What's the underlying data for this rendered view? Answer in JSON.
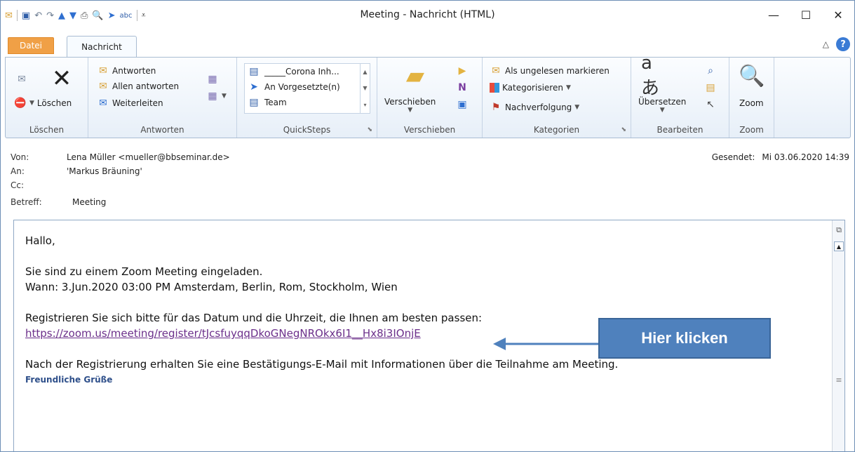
{
  "window": {
    "title": "Meeting - Nachricht (HTML)",
    "minimize": "—",
    "maximize": "☐",
    "close": "✕"
  },
  "qat": {
    "icons": [
      "mail-icon",
      "save-icon",
      "undo-icon",
      "redo-icon",
      "up-icon",
      "down-icon",
      "print-icon",
      "preview-icon",
      "send-icon",
      "spell-icon",
      "customize-icon"
    ]
  },
  "tabs": {
    "file": "Datei",
    "message": "Nachricht"
  },
  "ribbon": {
    "delete": {
      "delete_label": "Löschen",
      "group_label": "Löschen"
    },
    "respond": {
      "reply": "Antworten",
      "reply_all": "Allen antworten",
      "forward": "Weiterleiten",
      "group_label": "Antworten"
    },
    "quicksteps": {
      "items": [
        "_____Corona Inh...",
        "An Vorgesetzte(n)",
        "Team"
      ],
      "group_label": "QuickSteps"
    },
    "move": {
      "move_label": "Verschieben",
      "group_label": "Verschieben"
    },
    "tags": {
      "mark_unread": "Als ungelesen markieren",
      "categorize": "Kategorisieren",
      "followup": "Nachverfolgung",
      "group_label": "Kategorien"
    },
    "editing": {
      "translate": "Übersetzen",
      "group_label": "Bearbeiten"
    },
    "zoom": {
      "zoom_label": "Zoom",
      "group_label": "Zoom"
    }
  },
  "header": {
    "from_label": "Von:",
    "from_value": "Lena Müller <mueller@bbseminar.de>",
    "to_label": "An:",
    "to_value": "'Markus Bräuning'",
    "cc_label": "Cc:",
    "cc_value": "",
    "subject_label": "Betreff:",
    "subject_value": "Meeting",
    "sent_label": "Gesendet:",
    "sent_value": "Mi 03.06.2020 14:39"
  },
  "body": {
    "greeting": "Hallo,",
    "line1": "Sie sind zu einem Zoom Meeting eingeladen.",
    "line2": "Wann: 3.Jun.2020 03:00 PM Amsterdam, Berlin, Rom, Stockholm, Wien",
    "line3": "Registrieren Sie sich bitte für das Datum und die Uhrzeit, die Ihnen am besten passen:",
    "link": "https://zoom.us/meeting/register/tJcsfuyqqDkoGNegNROkx6I1__Hx8i3IOnjE",
    "line4": "Nach der Registrierung erhalten Sie eine Bestätigungs-E-Mail mit Informationen über die Teilnahme am Meeting.",
    "regards": "Freundliche Grüße"
  },
  "callout": {
    "text": "Hier klicken"
  },
  "colors": {
    "accent": "#4f81bd",
    "file_tab": "#f0a046",
    "link": "#6b2f8a"
  }
}
